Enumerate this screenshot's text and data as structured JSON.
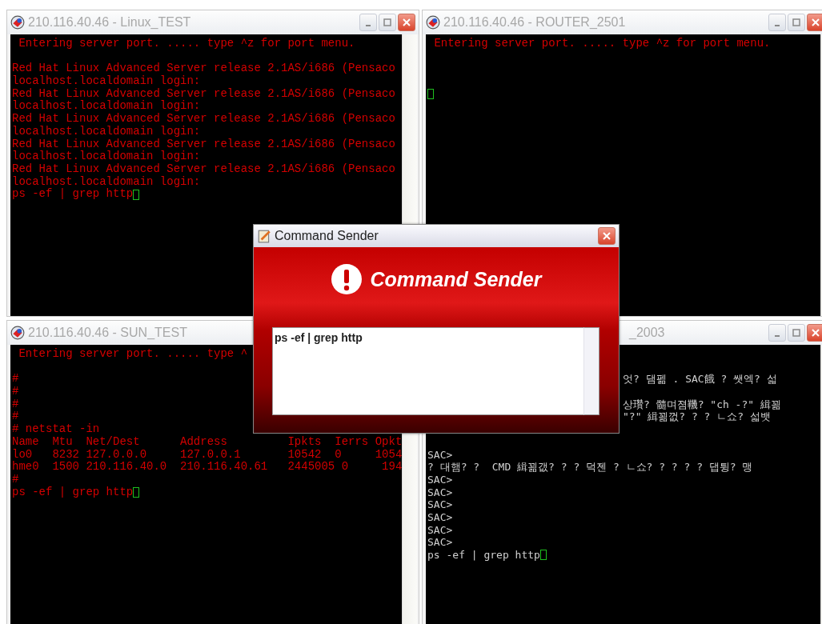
{
  "windows": [
    {
      "title": "210.116.40.46 - Linux_TEST",
      "color": "#d40000",
      "lines": [
        {
          "kind": "text",
          "text": " Entering server port. ..... type ^z for port menu."
        },
        {
          "kind": "blank"
        },
        {
          "kind": "text",
          "text": "Red Hat Linux Advanced Server release 2.1AS/i686 (Pensaco"
        },
        {
          "kind": "text",
          "text": "localhost.localdomain login:"
        },
        {
          "kind": "text",
          "text": "Red Hat Linux Advanced Server release 2.1AS/i686 (Pensaco"
        },
        {
          "kind": "text",
          "text": "localhost.localdomain login:"
        },
        {
          "kind": "text",
          "text": "Red Hat Linux Advanced Server release 2.1AS/i686 (Pensaco"
        },
        {
          "kind": "text",
          "text": "localhost.localdomain login:"
        },
        {
          "kind": "text",
          "text": "Red Hat Linux Advanced Server release 2.1AS/i686 (Pensaco"
        },
        {
          "kind": "text",
          "text": "localhost.localdomain login:"
        },
        {
          "kind": "text",
          "text": "Red Hat Linux Advanced Server release 2.1AS/i686 (Pensaco"
        },
        {
          "kind": "text",
          "text": "localhost.localdomain login:"
        },
        {
          "kind": "text",
          "text": "ps -ef | grep http",
          "cursor": true
        }
      ]
    },
    {
      "title": "210.116.40.46 - ROUTER_2501",
      "color": "#d40000",
      "lines": [
        {
          "kind": "text",
          "text": " Entering server port. ..... type ^z for port menu."
        },
        {
          "kind": "blank"
        },
        {
          "kind": "blank"
        },
        {
          "kind": "blank"
        },
        {
          "kind": "cursor"
        }
      ]
    },
    {
      "title": "210.116.40.46 - SUN_TEST",
      "color": "#d40000",
      "lines": [
        {
          "kind": "text",
          "text": " Entering server port. ..... type ^"
        },
        {
          "kind": "blank"
        },
        {
          "kind": "text",
          "text": "#"
        },
        {
          "kind": "text",
          "text": "#"
        },
        {
          "kind": "text",
          "text": "#"
        },
        {
          "kind": "text",
          "text": "#"
        },
        {
          "kind": "text",
          "text": "# netstat -in"
        },
        {
          "kind": "text",
          "text": "Name  Mtu  Net/Dest      Address         Ipkts  Ierrs Opkt"
        },
        {
          "kind": "text",
          "text": "lo0   8232 127.0.0.0     127.0.0.1       10542  0     1054"
        },
        {
          "kind": "text",
          "text": "hme0  1500 210.116.40.0  210.116.40.61   2445005 0     194"
        },
        {
          "kind": "text",
          "text": "#"
        },
        {
          "kind": "text",
          "text": "ps -ef | grep http",
          "cursor": true
        }
      ]
    },
    {
      "title": "_2003",
      "color": "#d0d0d0",
      "lines": [
        {
          "kind": "blank"
        },
        {
          "kind": "blank"
        },
        {
          "kind": "covered",
          "text": "엇? 댐펢 . SAC餓 ? 쌧엑? 섧"
        },
        {
          "kind": "blank"
        },
        {
          "kind": "covered",
          "text": "상瓚? 髓며졈鞿? \"ch -?\" 緝꾊"
        },
        {
          "kind": "covered",
          "text": "\"?\" 緝꾊껎? ? ? ㄴ쇼? 섧뱃"
        },
        {
          "kind": "blank"
        },
        {
          "kind": "blank"
        },
        {
          "kind": "text",
          "text": "SAC>"
        },
        {
          "kind": "text",
          "text": "? 대햄? ?  CMD 緝꾊갮? ? ? 덕젠 ? ㄴ쇼? ? ? ? ? 댑튕? 맹"
        },
        {
          "kind": "text",
          "text": "SAC>"
        },
        {
          "kind": "text",
          "text": "SAC>"
        },
        {
          "kind": "text",
          "text": "SAC>"
        },
        {
          "kind": "text",
          "text": "SAC>"
        },
        {
          "kind": "text",
          "text": "SAC>"
        },
        {
          "kind": "text",
          "text": "SAC>"
        },
        {
          "kind": "text",
          "text": "ps -ef | grep http",
          "cursor": true
        }
      ]
    }
  ],
  "dialog": {
    "title": "Command Sender",
    "heading": "Command Sender",
    "command": "ps -ef | grep http"
  }
}
